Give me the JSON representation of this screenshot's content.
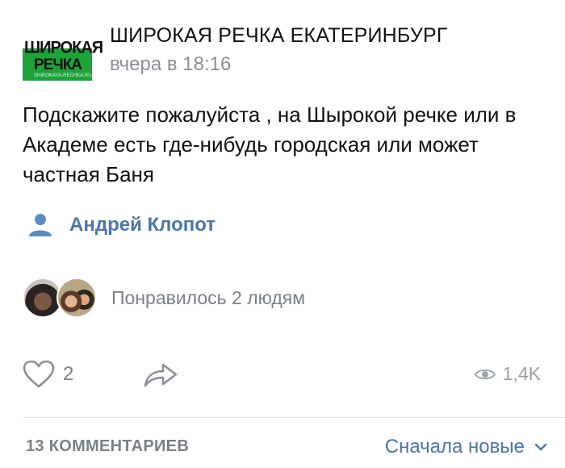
{
  "post": {
    "group_name": "ШИРОКАЯ РЕЧКА ЕКАТЕРИНБУРГ",
    "timestamp": "вчера в 18:16",
    "logo": {
      "line1": "ШИРОКАЯ",
      "line2": "РЕЧКА",
      "line3": "SHIROKAYA-RECHKA.RU"
    },
    "text": "Подскажите пожалуйста , на Шырокой речке или в Академе есть где-нибудь городская или может частная Баня",
    "author": "Андрей Клопот",
    "likes_text": "Понравилось 2 людям",
    "like_count": "2",
    "views": "1,4K"
  },
  "comments": {
    "count_label": "13 КОММЕНТАРИЕВ",
    "sort_label": "Сначала новые"
  },
  "colors": {
    "link": "#4a76a8",
    "muted": "#7b8087",
    "logo_green": "#1ea33a"
  },
  "icons": {
    "author": "person-icon",
    "like": "heart-icon",
    "share": "share-arrow-icon",
    "views": "eye-icon",
    "sort": "chevron-down-icon"
  }
}
